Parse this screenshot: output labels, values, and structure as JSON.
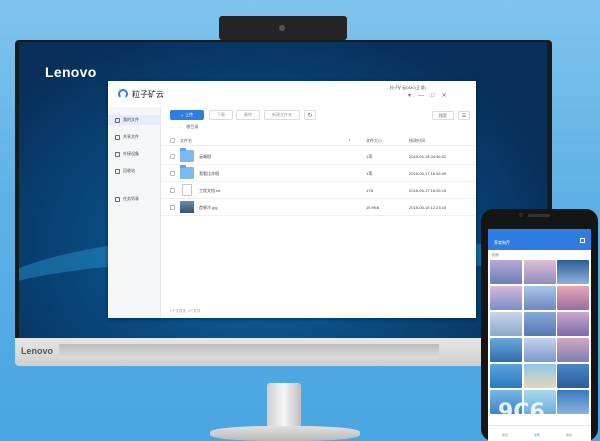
{
  "monitor": {
    "brand": "Lenovo",
    "chin_brand": "Lenovo"
  },
  "app": {
    "title": "粒子矿云",
    "user": "粒子矿云DMO(正常)",
    "window_buttons": [
      "▾",
      "—",
      "□",
      "✕"
    ],
    "sidebar": [
      {
        "label": "我的文件",
        "icon": "folder-icon",
        "active": true
      },
      {
        "label": "共享文件",
        "icon": "share-icon",
        "active": false
      },
      {
        "label": "外接设备",
        "icon": "device-icon",
        "active": false
      },
      {
        "label": "回收站",
        "icon": "trash-icon",
        "active": false
      },
      {
        "label": "任务列表",
        "icon": "tasks-icon",
        "active": false
      }
    ],
    "toolbar": {
      "upload": "上传",
      "upload_icon": "+",
      "download": "下载",
      "delete": "删除",
      "new_folder": "新建文件夹",
      "refresh_icon": "↻",
      "search": "搜索",
      "view_icon": "☰"
    },
    "breadcrumb": {
      "back_icon": "←",
      "forward_icon": "→",
      "current": "根目录"
    },
    "table": {
      "columns": [
        "文件名",
        "文件大小",
        "修改时间"
      ],
      "sort_icon": "▼",
      "rows": [
        {
          "name": "云端相",
          "type": "folder",
          "size": "1项",
          "modified": "2018-05-18 04:56:31"
        },
        {
          "name": "我看比亦相",
          "type": "folder",
          "size": "1项",
          "modified": "2018-05-17 16:06:49"
        },
        {
          "name": "工程文档.txt",
          "type": "doc",
          "size": "17B",
          "modified": "2018-05-17 15:26:15"
        },
        {
          "name": "首果冷.jpg",
          "type": "image",
          "size": "15.9KB",
          "modified": "2018-05-18 12:23:10"
        }
      ]
    },
    "status": "2个文件夹, 2个文件"
  },
  "phone": {
    "header_title": "养育狗芹",
    "subtitle": "相册",
    "nav": [
      "首页",
      "文件",
      "我的"
    ]
  },
  "watermark": "9C6"
}
